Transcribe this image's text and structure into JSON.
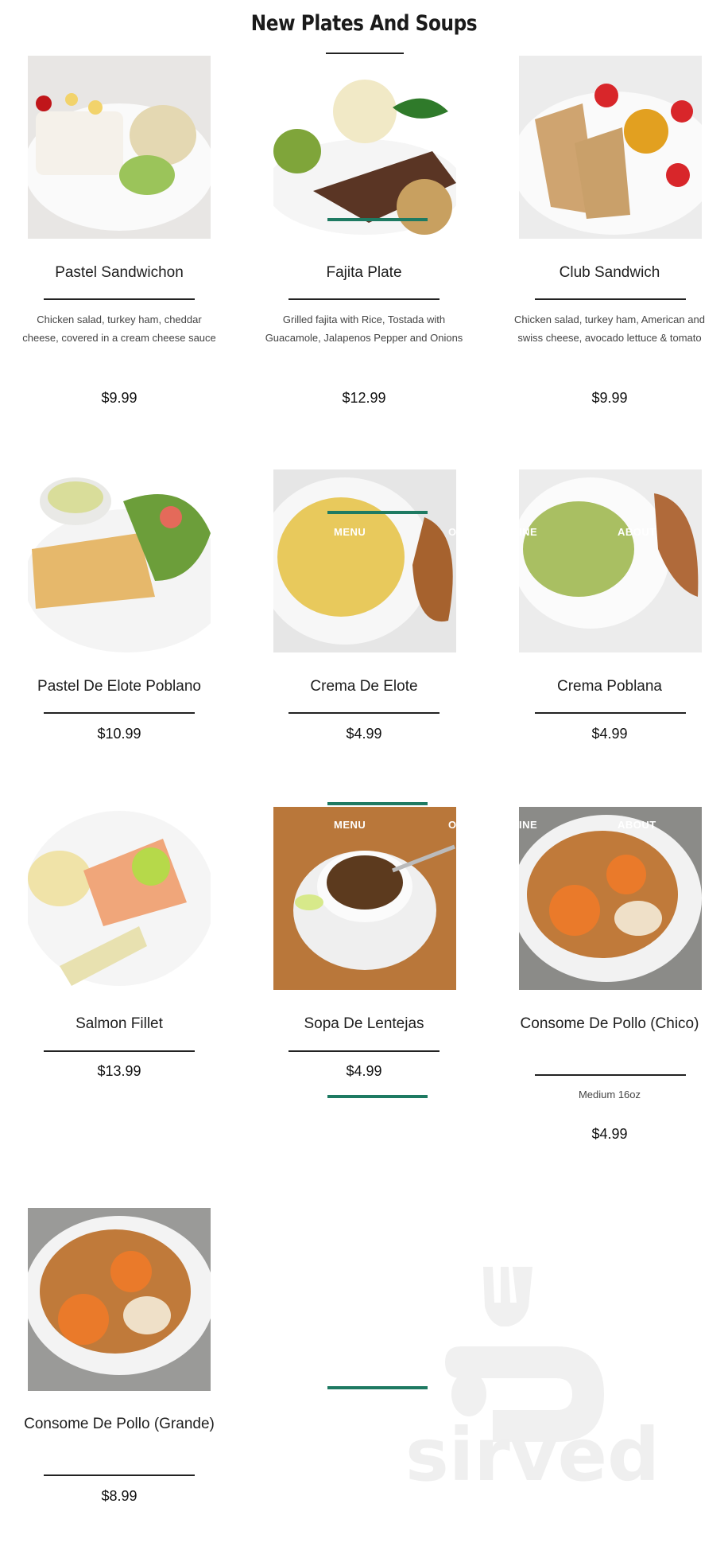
{
  "page": {
    "title": "New Plates And Soups"
  },
  "items": [
    {
      "name": "Pastel Sandwichon",
      "desc": "Chicken salad, turkey ham, cheddar cheese, covered in a cream cheese sauce",
      "price": "$9.99"
    },
    {
      "name": "Fajita Plate",
      "desc": "Grilled fajita with Rice, Tostada with Guacamole, Jalapenos Pepper and Onions",
      "price": "$12.99"
    },
    {
      "name": "Club Sandwich",
      "desc": "Chicken salad, turkey ham, American and swiss cheese, avocado lettuce & tomato",
      "price": "$9.99"
    },
    {
      "name": "Pastel De Elote Poblano",
      "price": "$10.99"
    },
    {
      "name": "Crema De Elote",
      "price": "$4.99"
    },
    {
      "name": "Crema Poblana",
      "price": "$4.99"
    },
    {
      "name": "Salmon Fillet",
      "price": "$13.99"
    },
    {
      "name": "Sopa De Lentejas",
      "price": "$4.99"
    },
    {
      "name": "Consome De Pollo (Chico)",
      "desc": "Medium 16oz",
      "price": "$4.99"
    },
    {
      "name": "Consome De Pollo (Grande)",
      "price": "$8.99"
    }
  ],
  "overlay_nav": {
    "menu": "MENU",
    "online": "O",
    "line": "INE",
    "about": "ABOUT"
  },
  "watermark": {
    "text": "sirved"
  },
  "colors": {
    "accent": "#1e7a62",
    "rule": "#222222"
  }
}
